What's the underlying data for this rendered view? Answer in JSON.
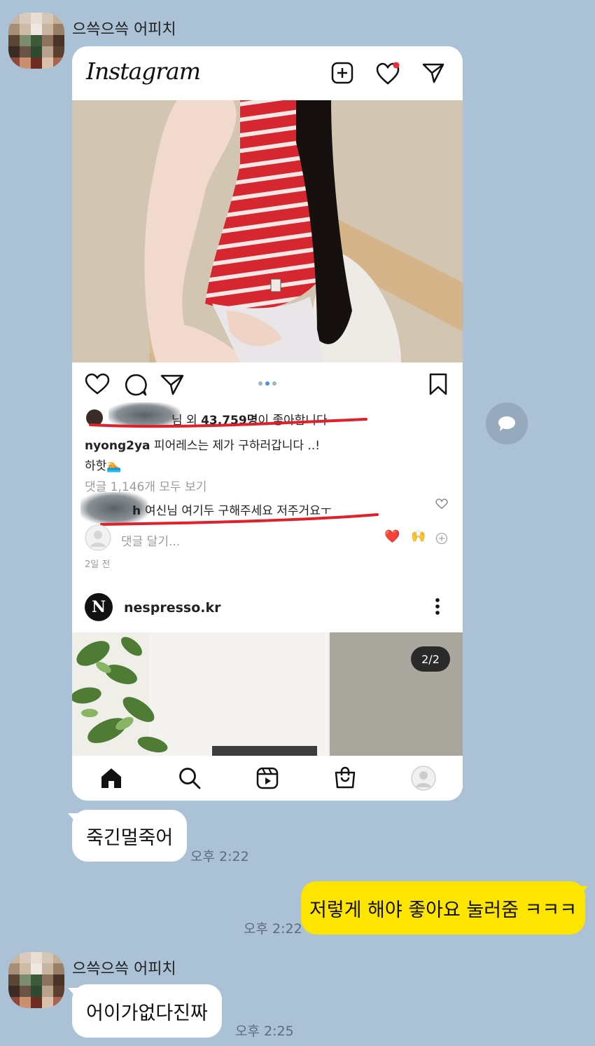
{
  "chat": {
    "sender_name": "으쓱으쓱 어피치",
    "messages": [
      {
        "text": "죽긴멀죽어",
        "time": "오후 2:22"
      },
      {
        "text": "저렇게 해야 좋아요 눌러줌 ㅋㅋㅋ",
        "time": "오후 2:22"
      },
      {
        "text": "어이가없다진짜",
        "time": "오후 2:25"
      }
    ]
  },
  "instagram": {
    "logo": "Instagram",
    "likes_text_pre": "님 외 ",
    "likes_count": "43,759명",
    "likes_text_post": "이 좋아합니다",
    "caption_user": "nyong2ya",
    "caption_text": " 피어레스는 제가 구하러갑니다 ..!",
    "caption_line2": "하핫🏊",
    "view_comments": "댓글 1,146개 모두 보기",
    "comment_text": "여신님 여기두 구해주세요 저주거요ㅜ",
    "comment_placeholder": "댓글 달기...",
    "time_ago": "2일 전",
    "next_account": "nespresso.kr",
    "next_logo_letter": "N",
    "page_badge": "2/2",
    "emoji_heart": "❤️",
    "emoji_hands": "🙌",
    "carousel_dots": 3
  },
  "colors": {
    "chat_bg": "#abc1d6",
    "my_bubble": "#fee500",
    "underline_red": "#e0202a"
  }
}
